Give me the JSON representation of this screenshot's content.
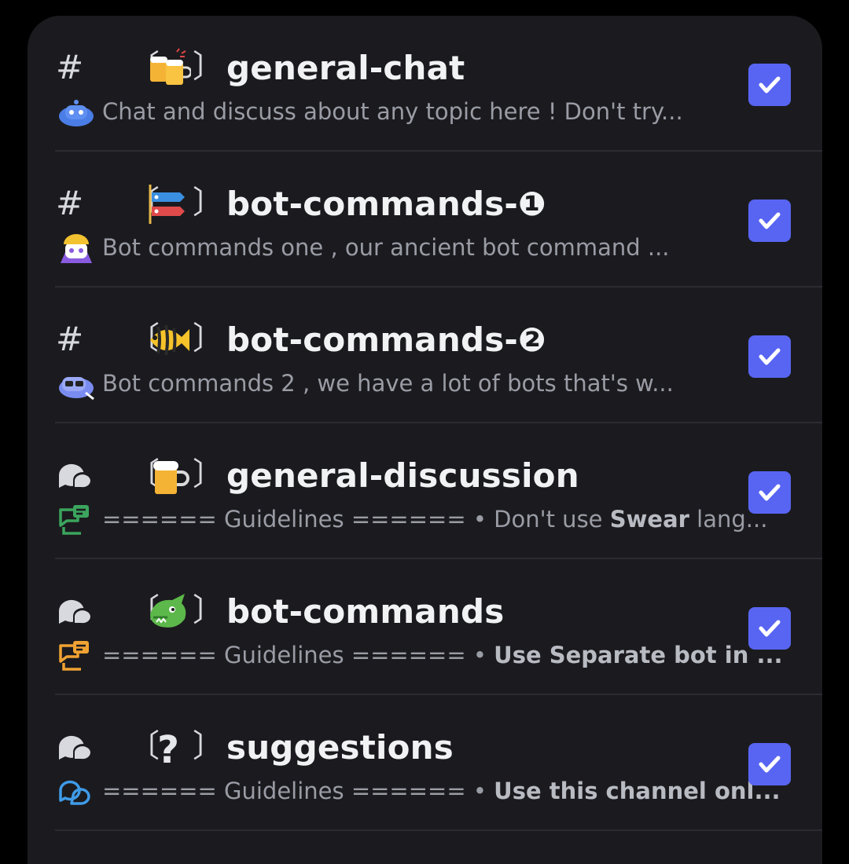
{
  "channels": [
    {
      "type": "text",
      "type_icon": "hash-icon",
      "emoji_icon": "beer-mugs-icon",
      "name": "general-chat",
      "desc_icon": "clyde-robot-icon",
      "desc_color": "#4a7de6",
      "description": "Chat and discuss about any topic here ! Don't try...",
      "description_bold": "",
      "description_suffix": "",
      "checked": true
    },
    {
      "type": "text",
      "type_icon": "hash-icon",
      "emoji_icon": "carp-streamer-icon",
      "name": "bot-commands-❶",
      "desc_icon": "builder-robot-icon",
      "desc_color": "#8a5be0",
      "description": "Bot commands one , our ancient bot command ...",
      "description_bold": "",
      "description_suffix": "",
      "checked": true
    },
    {
      "type": "text",
      "type_icon": "hash-icon",
      "emoji_icon": "tropical-fish-icon",
      "name": "bot-commands-❷",
      "desc_icon": "cool-robot-icon",
      "desc_color": "#7a8cf0",
      "description": "Bot commands 2 , we have a lot of bots that's w...",
      "description_bold": "",
      "description_suffix": "",
      "checked": true
    },
    {
      "type": "forum",
      "type_icon": "forum-bubbles-icon",
      "emoji_icon": "beer-mug-icon",
      "name": "general-discussion",
      "desc_icon": "guidelines-chat-icon",
      "desc_color": "#3ba55d",
      "description": "====== Guidelines ====== • Don't use ",
      "description_bold": "Swear",
      "description_suffix": " lang...",
      "checked": true
    },
    {
      "type": "forum",
      "type_icon": "forum-bubbles-icon",
      "emoji_icon": "dragon-face-icon",
      "name": "bot-commands",
      "desc_icon": "guidelines-chat-icon",
      "desc_color": "#f0a232",
      "description": "====== Guidelines ====== • ",
      "description_bold": "Use Separate bot in ...",
      "description_suffix": "",
      "checked": true
    },
    {
      "type": "forum",
      "type_icon": "forum-bubbles-icon",
      "emoji_icon": "question-mark-icon",
      "name": "suggestions",
      "desc_icon": "chat-bubbles-icon",
      "desc_color": "#3f9be8",
      "description": "====== Guidelines ====== • ",
      "description_bold": "Use this channel onl...",
      "description_suffix": "",
      "checked": true
    }
  ],
  "colors": {
    "background": "#000000",
    "panel": "#1b1b1f",
    "checkbox": "#5865f2",
    "title": "#f1f2f4",
    "muted": "#9a9ca5"
  }
}
